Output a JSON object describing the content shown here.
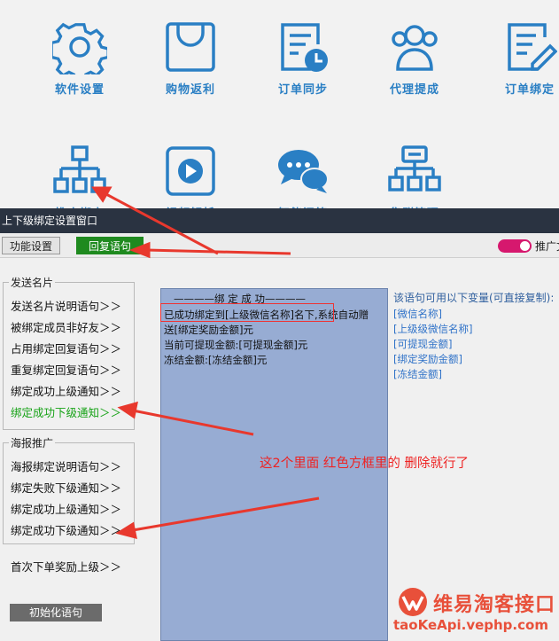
{
  "top_icons": [
    {
      "label": "软件设置",
      "icon": "gear-icon"
    },
    {
      "label": "购物返利",
      "icon": "shopping-bag-icon"
    },
    {
      "label": "订单同步",
      "icon": "order-clock-icon"
    },
    {
      "label": "代理提成",
      "icon": "users-icon"
    },
    {
      "label": "订单绑定",
      "icon": "document-edit-icon"
    },
    {
      "label": "推广绑定",
      "icon": "org-chart-icon"
    },
    {
      "label": "视频解析",
      "icon": "play-icon"
    },
    {
      "label": "智能问答",
      "icon": "chat-icon"
    },
    {
      "label": "集群管理",
      "icon": "cluster-icon"
    }
  ],
  "window": {
    "title": "上下级绑定设置窗口",
    "tabs": {
      "settings": "功能设置",
      "reply": "回复语句"
    },
    "toggle_label": "推广文",
    "accent": "#d6186e"
  },
  "group1": {
    "title": "发送名片",
    "items": [
      "发送名片说明语句＞＞",
      "被绑定成员非好友＞＞",
      "占用绑定回复语句＞＞",
      "重复绑定回复语句＞＞",
      "绑定成功上级通知＞＞",
      "绑定成功下级通知＞＞"
    ]
  },
  "group2": {
    "title": "海报推广",
    "items": [
      "海报绑定说明语句＞＞",
      "绑定失败下级通知＞＞",
      "绑定成功上级通知＞＞",
      "绑定成功下级通知＞＞"
    ]
  },
  "extra_item": "首次下单奖励上级＞＞",
  "init_button": "初始化语句",
  "editor": {
    "header": "————绑 定 成 功————",
    "lines": [
      "已成功绑定到[上级微信名称]名下,系统自动赠",
      "送[绑定奖励金额]元",
      "当前可提现金额:[可提现金额]元",
      "冻结金额:[冻结金额]元"
    ]
  },
  "variables": {
    "title": "该语句可用以下变量(可直接复制):",
    "items": [
      "[微信名称]",
      "[上级级微信名称]",
      "[可提现金额]",
      "[绑定奖励金额]",
      "[冻结金额]"
    ]
  },
  "annotation": "这2个里面  红色方框里的  删除就行了",
  "logo": {
    "name": "维易淘客接口",
    "url": "taoKeApi.vephp.com"
  }
}
